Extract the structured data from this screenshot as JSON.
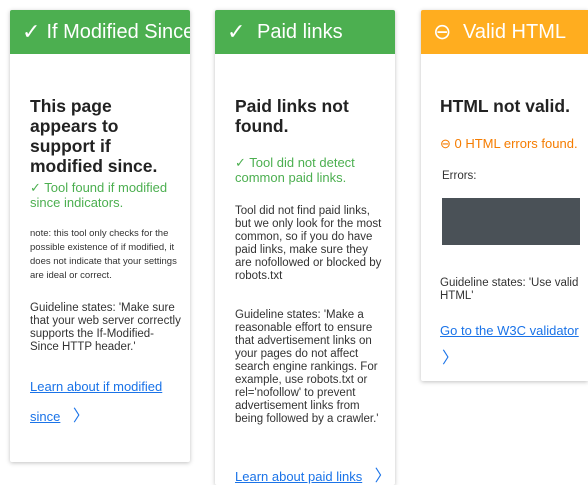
{
  "cards": [
    {
      "header": {
        "icon": "✓",
        "title": "If Modified Since"
      },
      "heading": "This page appears to support if modified since.",
      "status": "✓ Tool found if modified since indicators.",
      "note": "note: this tool only checks for the possible existence of if modified, it does not indicate that your settings are ideal or correct.",
      "guideline": "Guideline states: 'Make sure that your web server correctly supports the If-Modified-Since HTTP header.'",
      "link_line1": "Learn about if modified",
      "link_line2": "since",
      "chevron": "〉"
    },
    {
      "header": {
        "icon": "✓",
        "title": "Paid links"
      },
      "heading": "Paid links not found.",
      "status": "✓ Tool did not detect common paid links.",
      "body": "Tool did not find paid links, but we only look for the most common, so if you do have paid links, make sure they are nofollowed or blocked by robots.txt",
      "guideline": "Guideline states: 'Make a reasonable effort to ensure that advertisement links on your pages do not affect search engine rankings. For example, use robots.txt or rel='nofollow' to prevent advertisement links from being followed by a crawler.'",
      "link": "Learn about paid links",
      "chevron": "〉"
    },
    {
      "header": {
        "icon": "⊖",
        "title": "Valid HTML"
      },
      "heading": "HTML not valid.",
      "status": "⊖ 0 HTML errors found.",
      "errors_label": "Errors:",
      "guideline": "Guideline states: 'Use valid HTML'",
      "link": "Go to the W3C validator",
      "chevron": "〉"
    }
  ],
  "colors": {
    "green": "#4caf50",
    "orange": "#ffad1f",
    "link": "#1a73e8"
  }
}
